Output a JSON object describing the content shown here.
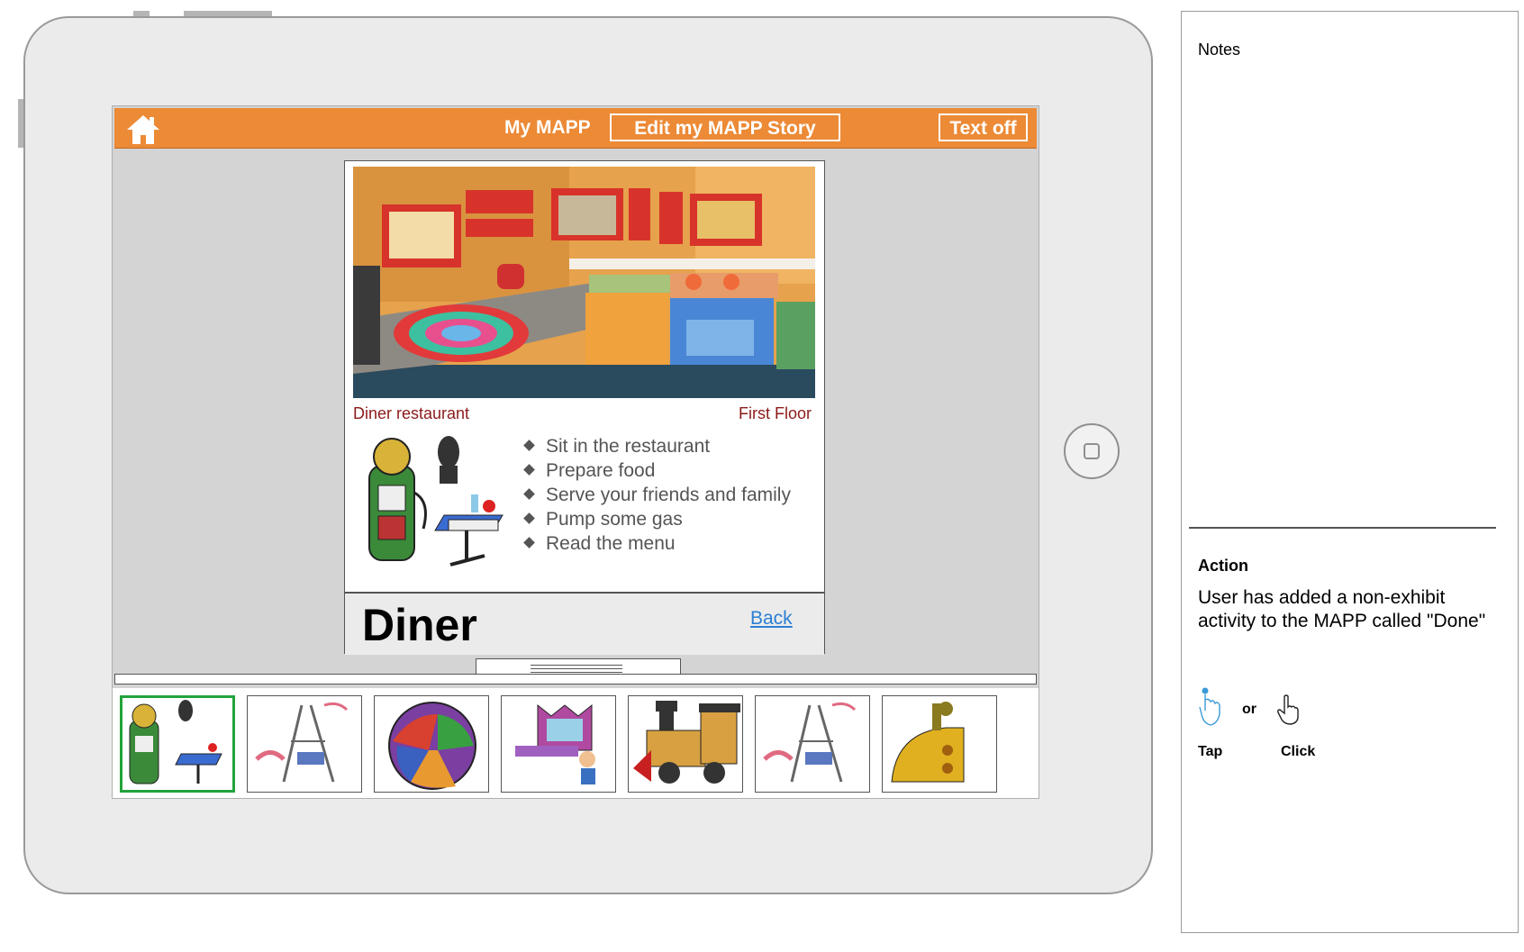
{
  "header": {
    "title": "My MAPP",
    "edit_story_button": "Edit my MAPP Story",
    "text_toggle_button": "Text off"
  },
  "card": {
    "location_name": "Diner restaurant",
    "floor": "First Floor",
    "activities": [
      "Sit in the restaurant",
      "Prepare food",
      "Serve your friends and family",
      "Pump some gas",
      "Read the menu"
    ],
    "title": "Diner",
    "back_link": "Back"
  },
  "thumbnails": [
    {
      "icon": "diner-gas-pump-icon",
      "selected": true
    },
    {
      "icon": "tower-sculpture-icon",
      "selected": false
    },
    {
      "icon": "colorful-sphere-icon",
      "selected": false
    },
    {
      "icon": "castle-boy-icon",
      "selected": false
    },
    {
      "icon": "wooden-train-icon",
      "selected": false
    },
    {
      "icon": "tower-sculpture-icon",
      "selected": false
    },
    {
      "icon": "yellow-submarine-icon",
      "selected": false
    }
  ],
  "notes": {
    "title": "Notes",
    "action_label": "Action",
    "action_text": "User has added a non-exhibit activity to the MAPP called \"Done\"",
    "or_label": "or",
    "tap_label": "Tap",
    "click_label": "Click"
  },
  "colors": {
    "header_orange": "#ec8a36",
    "selected_green": "#23a33a",
    "location_text": "#8b1a1a",
    "link_blue": "#2a7fd4"
  }
}
